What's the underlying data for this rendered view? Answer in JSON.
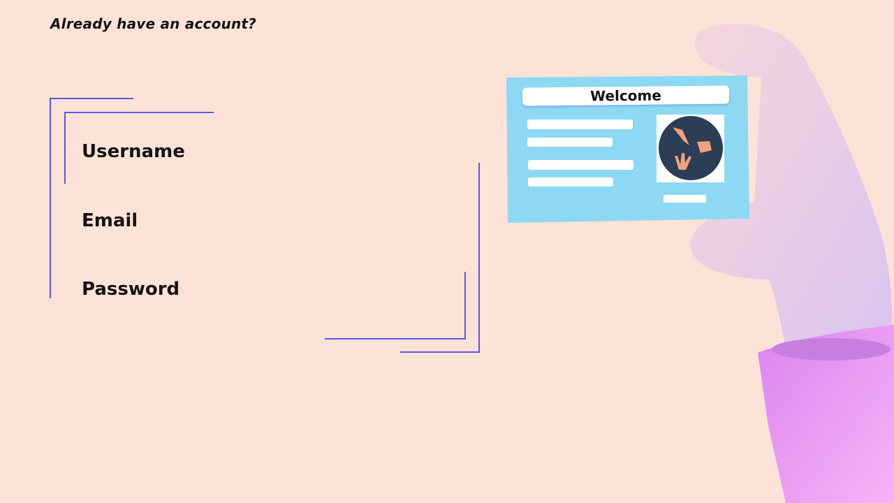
{
  "header": {
    "login_prompt": "Already have an account?"
  },
  "form": {
    "fields": [
      {
        "label": "Username",
        "value": ""
      },
      {
        "label": "Email",
        "value": ""
      },
      {
        "label": "Password",
        "value": ""
      }
    ]
  },
  "illustration": {
    "card_title": "Welcome"
  },
  "colors": {
    "background": "#fde3d7",
    "accent": "#5b55e6",
    "card": "#8dd9f3",
    "sleeve": "#e79cf3"
  }
}
